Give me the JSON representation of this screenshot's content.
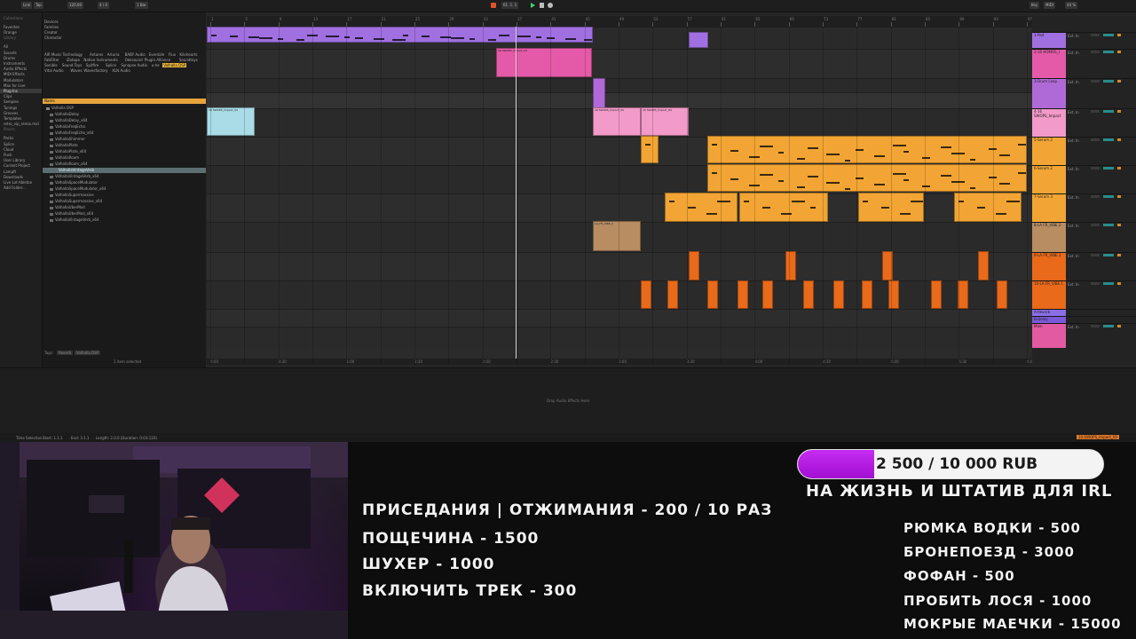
{
  "daw": {
    "browser": {
      "places": [
        {
          "label": "Collections",
          "head": true
        },
        {
          "label": "Favorites"
        },
        {
          "label": "Orange"
        },
        {
          "label": "Library",
          "head": true
        },
        {
          "label": "All"
        },
        {
          "label": "Sounds"
        },
        {
          "label": "Drums"
        },
        {
          "label": "Instruments"
        },
        {
          "label": "Audio Effects"
        },
        {
          "label": "MIDI Effects"
        },
        {
          "label": "Modulators"
        },
        {
          "label": "Max for Live"
        },
        {
          "label": "Plug-Ins",
          "selected": true
        },
        {
          "label": "Clips"
        },
        {
          "label": "Samples"
        },
        {
          "label": "Tunings"
        },
        {
          "label": "Grooves"
        },
        {
          "label": "Templates"
        },
        {
          "label": "retro_vip_remix.mid"
        },
        {
          "label": "Places",
          "head": true
        },
        {
          "label": "Packs"
        },
        {
          "label": "Splice"
        },
        {
          "label": "Cloud"
        },
        {
          "label": "Push"
        },
        {
          "label": "User Library"
        },
        {
          "label": "Current Project"
        },
        {
          "label": "Lampft"
        },
        {
          "label": "Downloads"
        },
        {
          "label": "Live Lot Ableton"
        },
        {
          "label": "Add Folder..."
        }
      ],
      "tag_groups": [
        "Devices",
        "Families",
        "Creator",
        "Character"
      ],
      "tags": [
        "AIR Music Technology",
        "Antares",
        "Arturia",
        "BABY Audio",
        "Eventide",
        "Flux",
        "Kilohearts",
        "FabFilter",
        "iZotope",
        "Native Instruments",
        "Oeksound",
        "Plugin Alliance",
        "Soundtoys",
        "Sonible",
        "Sound Toys",
        "Spitfire",
        "Splice",
        "Synapse Audio",
        "u-he",
        "Valhalla DSP",
        "Vital Audio",
        "Waves",
        "Wavesfactory",
        "XLN Audio"
      ],
      "highlight_tag": "Valhalla DSP",
      "list_header": "Name",
      "folder": "Valhalla DSP",
      "files": [
        "ValhallaDelay",
        "ValhallaDelay_x64",
        "ValhallaFreqEcho",
        "ValhallaFreqEcho_x64",
        "ValhallaShimmer",
        "ValhallaPlate",
        "ValhallaPlate_x64",
        "ValhallaRoom",
        "ValhallaRoom_x64",
        "ValhallaVintageVerb",
        "ValhallaVintageVerb_x64",
        "ValhallaSpaceModulator",
        "ValhallaSpaceModulator_x64",
        "ValhallaSupermassive",
        "ValhallaSupermassive_x64",
        "ValhallaUberMod",
        "ValhallaUberMod_x64",
        "ValhallaVintageVerb_x64"
      ],
      "selected_file": "ValhallaVintageVerb",
      "footer_label": "Tags",
      "footer_tags": [
        "Reverb",
        "Valhalla DSP"
      ],
      "selection_status": "1 item selected"
    },
    "transport": {
      "tempo": "120.00",
      "signature": "4 / 4",
      "quantize": "1 Bar",
      "position": "61. 1. 1",
      "cpu": "44 %",
      "key": "Key",
      "midi": "MIDI"
    },
    "ruler_marks": [
      "1",
      "5",
      "9",
      "13",
      "17",
      "21",
      "25",
      "29",
      "33",
      "37",
      "41",
      "45",
      "49",
      "53",
      "57",
      "61",
      "65",
      "69",
      "73",
      "77",
      "81",
      "85",
      "89",
      "93",
      "97"
    ],
    "time_marks": [
      "0:00",
      "0:30",
      "1:00",
      "1:30",
      "2:00",
      "2:30",
      "3:00",
      "3:30",
      "4:00",
      "4:30",
      "5:00",
      "5:30",
      "6:00"
    ],
    "tracks": [
      {
        "name": "1-Pad",
        "color": "#a070e0"
      },
      {
        "name": "2-16 HOMOS_I",
        "color": "#e55aa8"
      },
      {
        "name": "3-Drum Loop",
        "color": "#b06ad8"
      },
      {
        "name": "4-16 SWOPS_Impact",
        "color": "#f29ac9"
      },
      {
        "name": "5-Serum 2",
        "color": "#f2a534"
      },
      {
        "name": "6-Serum 2",
        "color": "#f2a534"
      },
      {
        "name": "7-Serum 3",
        "color": "#f2a534"
      },
      {
        "name": "8-LA FR_VIBE 2",
        "color": "#b88d62"
      },
      {
        "name": "9-LA FR_VIBE 3",
        "color": "#e86a1a"
      },
      {
        "name": "10-LA FR_VIBE 1",
        "color": "#e86a1a"
      },
      {
        "name": "A-Reverb",
        "color": "#8a6ee6"
      },
      {
        "name": "B-Delay",
        "color": "#7a5ad8"
      },
      {
        "name": "Main",
        "color": "#e25aa2"
      }
    ],
    "clip_labels": {
      "impact": "16 SWOPS_Impact_04",
      "vibe": "LA_FR_VIBE_2"
    },
    "mixer_sends": "Ext. In",
    "drop_hint": "Drop Audio Effects Here",
    "status_left": "Time Selection",
    "status_start": "Start: 1.1.1",
    "status_end": "End: 3.1.1",
    "status_length": "Length: 2.0.0 (Duration: 0:03:120)",
    "status_right": "10-SWOPS_Impact_05"
  },
  "overlay": {
    "goal": {
      "current": "2 500",
      "target": "10 000",
      "currency": "RUB",
      "text": "2 500 / 10 000 RUB",
      "progress": 0.25,
      "caption": "НА ЖИЗНЬ И ШТАТИВ ДЛЯ IRL"
    },
    "left_list": [
      "ПРИСЕДАНИЯ | ОТЖИМАНИЯ - 200 / 10 РАЗ",
      "ПОЩЕЧИНА - 1500",
      "ШУХЕР - 1000",
      "ВКЛЮЧИТЬ ТРЕК - 300"
    ],
    "right_list": [
      "РЮМКА ВОДКИ - 500",
      "БРОНЕПОЕЗД - 3000",
      "ФОФАН - 500",
      "ПРОБИТЬ ЛОСЯ - 1000",
      "МОКРЫЕ МАЕЧКИ - 15000"
    ]
  },
  "colors": {
    "accent": "#e9a43b",
    "goal_fill": "#b81fe0",
    "purple": "#a070e0",
    "pink": "#e55aa8",
    "orange": "#f2a534"
  }
}
